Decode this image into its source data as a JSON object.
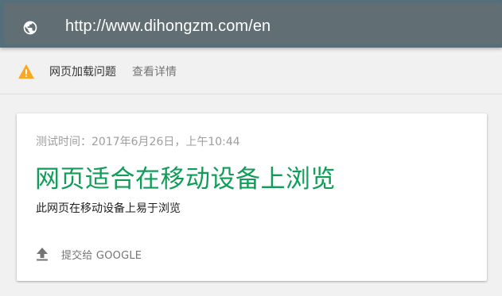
{
  "address_bar": {
    "url": "http://www.dihongzm.com/en",
    "icon": "globe-icon"
  },
  "warning": {
    "icon": "warning-icon",
    "icon_color": "#f9a825",
    "message": "网页加载问题",
    "details_link": "查看详情"
  },
  "result": {
    "test_time": "测试时间：2017年6月26日，上午10:44",
    "verdict": "网页适合在移动设备上浏览",
    "verdict_color": "#0f9d58",
    "description": "此网页在移动设备上易于浏览",
    "submit": {
      "icon": "upload-icon",
      "label": "提交给 GOOGLE"
    }
  }
}
